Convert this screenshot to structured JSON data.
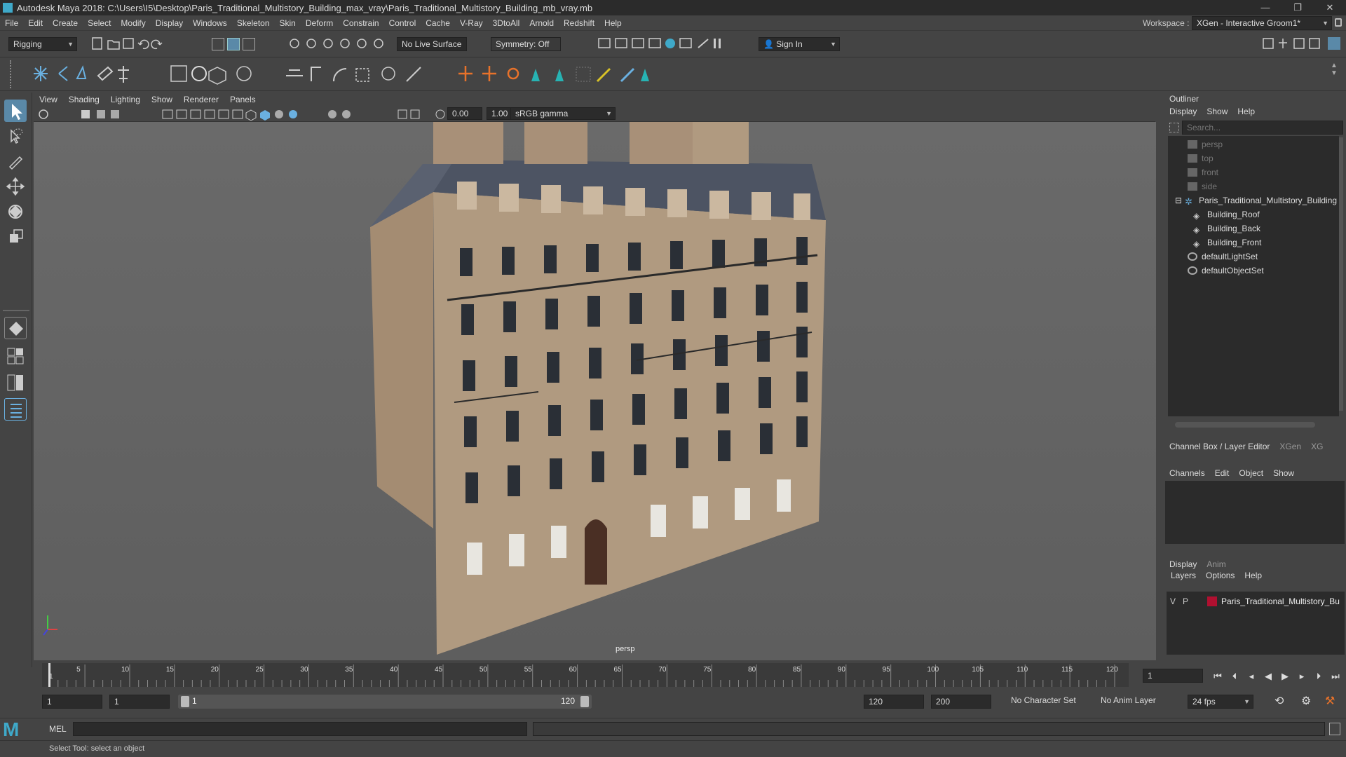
{
  "window": {
    "title": "Autodesk Maya 2018: C:\\Users\\I5\\Desktop\\Paris_Traditional_Multistory_Building_max_vray\\Paris_Traditional_Multistory_Building_mb_vray.mb"
  },
  "menubar": {
    "items": [
      "File",
      "Edit",
      "Create",
      "Select",
      "Modify",
      "Display",
      "Windows",
      "Skeleton",
      "Skin",
      "Deform",
      "Constrain",
      "Control",
      "Cache",
      "V-Ray",
      "3DtoAll",
      "Arnold",
      "Redshift",
      "Help"
    ],
    "workspace_label": "Workspace :",
    "workspace_value": "XGen - Interactive Groom1*"
  },
  "statusline": {
    "mode": "Rigging",
    "live_surface": "No Live Surface",
    "symmetry": "Symmetry: Off",
    "sign_in": "Sign In"
  },
  "viewport": {
    "menu": [
      "View",
      "Shading",
      "Lighting",
      "Show",
      "Renderer",
      "Panels"
    ],
    "exposure": "0.00",
    "gamma": "1.00",
    "color_space": "sRGB gamma",
    "camera_label": "persp"
  },
  "outliner": {
    "title": "Outliner",
    "menu": [
      "Display",
      "Show",
      "Help"
    ],
    "search_placeholder": "Search...",
    "items": [
      {
        "label": "persp",
        "type": "camera",
        "indent": 0,
        "dim": true
      },
      {
        "label": "top",
        "type": "camera",
        "indent": 0,
        "dim": true
      },
      {
        "label": "front",
        "type": "camera",
        "indent": 0,
        "dim": true
      },
      {
        "label": "side",
        "type": "camera",
        "indent": 0,
        "dim": true
      },
      {
        "label": "Paris_Traditional_Multistory_Building",
        "type": "group",
        "indent": 0,
        "dim": false
      },
      {
        "label": "Building_Roof",
        "type": "mesh",
        "indent": 1,
        "dim": false
      },
      {
        "label": "Building_Back",
        "type": "mesh",
        "indent": 1,
        "dim": false
      },
      {
        "label": "Building_Front",
        "type": "mesh",
        "indent": 1,
        "dim": false
      },
      {
        "label": "defaultLightSet",
        "type": "set",
        "indent": 0,
        "dim": false
      },
      {
        "label": "defaultObjectSet",
        "type": "set",
        "indent": 0,
        "dim": false
      }
    ]
  },
  "channelbox": {
    "tabs": [
      "Channel Box / Layer Editor",
      "XGen",
      "XG"
    ],
    "menu": [
      "Channels",
      "Edit",
      "Object",
      "Show"
    ],
    "layer_tabs": [
      "Display",
      "Anim"
    ],
    "layer_menu": [
      "Layers",
      "Options",
      "Help"
    ],
    "layer": {
      "v": "V",
      "p": "P",
      "name": "Paris_Traditional_Multistory_Bu",
      "color": "#b01030"
    }
  },
  "timeline": {
    "ticks": [
      "5",
      "10",
      "15",
      "20",
      "25",
      "30",
      "35",
      "40",
      "45",
      "50",
      "55",
      "60",
      "65",
      "70",
      "75",
      "80",
      "85",
      "90",
      "95",
      "100",
      "105",
      "110",
      "115",
      "120"
    ],
    "first": "1",
    "current_frame": "1"
  },
  "range": {
    "start": "1",
    "anim_start": "1",
    "slider_start": "1",
    "slider_end": "120",
    "end": "120",
    "anim_end": "200",
    "character_set": "No Character Set",
    "anim_layer": "No Anim Layer",
    "fps": "24 fps"
  },
  "cmdline": {
    "label": "MEL"
  },
  "helpline": {
    "text": "Select Tool: select an object"
  },
  "colors": {
    "accent": "#5a89a8",
    "teal_icon": "#27b3b3",
    "orange_icon": "#e8722a",
    "yellow_icon": "#d8c227"
  }
}
